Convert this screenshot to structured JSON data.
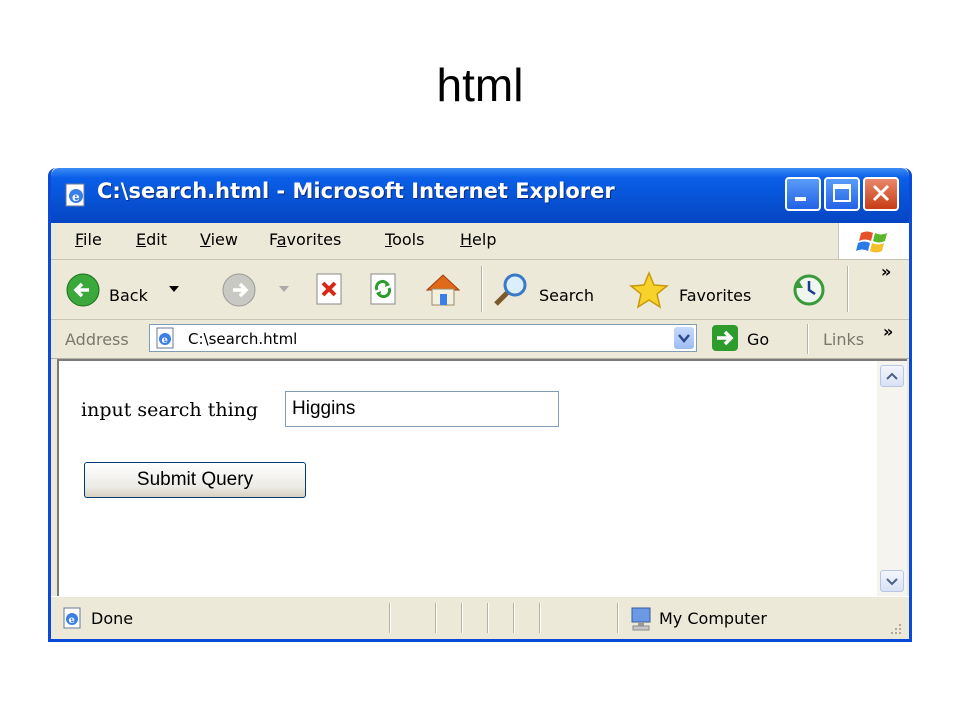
{
  "slide": {
    "title": "html"
  },
  "window": {
    "title": "C:\\search.html - Microsoft Internet Explorer"
  },
  "menu": {
    "items": [
      {
        "label": "File",
        "accel": "F",
        "rest": "ile"
      },
      {
        "label": "Edit",
        "accel": "E",
        "rest": "dit"
      },
      {
        "label": "View",
        "accel": "V",
        "rest": "iew"
      },
      {
        "label": "Favorites",
        "pre": "F",
        "accel": "a",
        "rest": "vorites"
      },
      {
        "label": "Tools",
        "accel": "T",
        "rest": "ools"
      },
      {
        "label": "Help",
        "accel": "H",
        "rest": "elp"
      }
    ]
  },
  "toolbar": {
    "back_label": "Back",
    "search_label": "Search",
    "favorites_label": "Favorites",
    "overflow": "»",
    "icons": [
      "back-icon",
      "forward-icon",
      "stop-icon",
      "refresh-icon",
      "home-icon",
      "search-icon",
      "favorites-icon",
      "history-icon"
    ]
  },
  "address": {
    "label": "Address",
    "url": "C:\\search.html",
    "go_label": "Go",
    "links_label": "Links",
    "links_overflow": "»"
  },
  "page": {
    "search_label": "input search thing",
    "search_value": "Higgins",
    "submit_label": "Submit Query"
  },
  "status": {
    "text": "Done",
    "zone": "My Computer"
  },
  "colors": {
    "titlebar": "#0753d6",
    "window_frame": "#0a4ad8",
    "chrome": "#ece9d8",
    "go_green": "#2d9c2d"
  }
}
